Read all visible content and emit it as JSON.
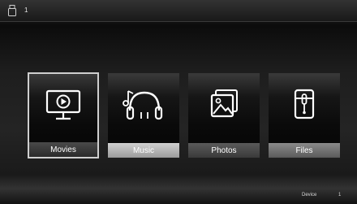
{
  "statusbar": {
    "indicator_value": "1",
    "usb_icon": "usb-drive-icon"
  },
  "tiles": [
    {
      "label": "Movies",
      "icon": "tv-play-icon",
      "selected": true
    },
    {
      "label": "Music",
      "icon": "headphones-music-icon",
      "selected": false
    },
    {
      "label": "Photos",
      "icon": "photo-stack-icon",
      "selected": false
    },
    {
      "label": "Files",
      "icon": "folder-clip-icon",
      "selected": false
    }
  ],
  "footer": {
    "source_label": "Device",
    "source_value": "1"
  },
  "colors": {
    "background": "#1b1b1b",
    "selected_border": "#cfcfcf",
    "icon_stroke": "#ffffff"
  }
}
